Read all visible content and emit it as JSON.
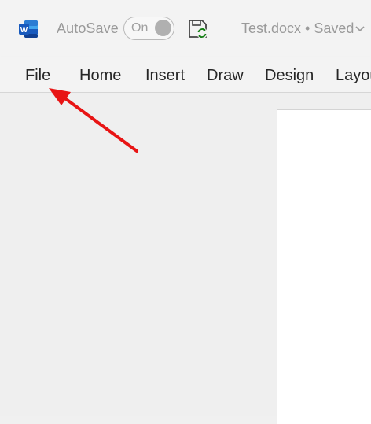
{
  "app": {
    "name": "Word",
    "icon": "word-logo-icon",
    "brand_color": "#185abd"
  },
  "titlebar": {
    "autosave_label": "AutoSave",
    "autosave_toggle_text": "On",
    "save_icon": "save-sync-icon",
    "document_title": "Test.docx • Saved",
    "title_menu_icon": "chevron-down-icon"
  },
  "ribbon": {
    "tabs": [
      {
        "label": "File"
      },
      {
        "label": "Home"
      },
      {
        "label": "Insert"
      },
      {
        "label": "Draw"
      },
      {
        "label": "Design"
      },
      {
        "label": "Layou"
      }
    ]
  },
  "annotation": {
    "icon": "red-arrow-icon",
    "color": "#e81414",
    "points_to": "File"
  }
}
